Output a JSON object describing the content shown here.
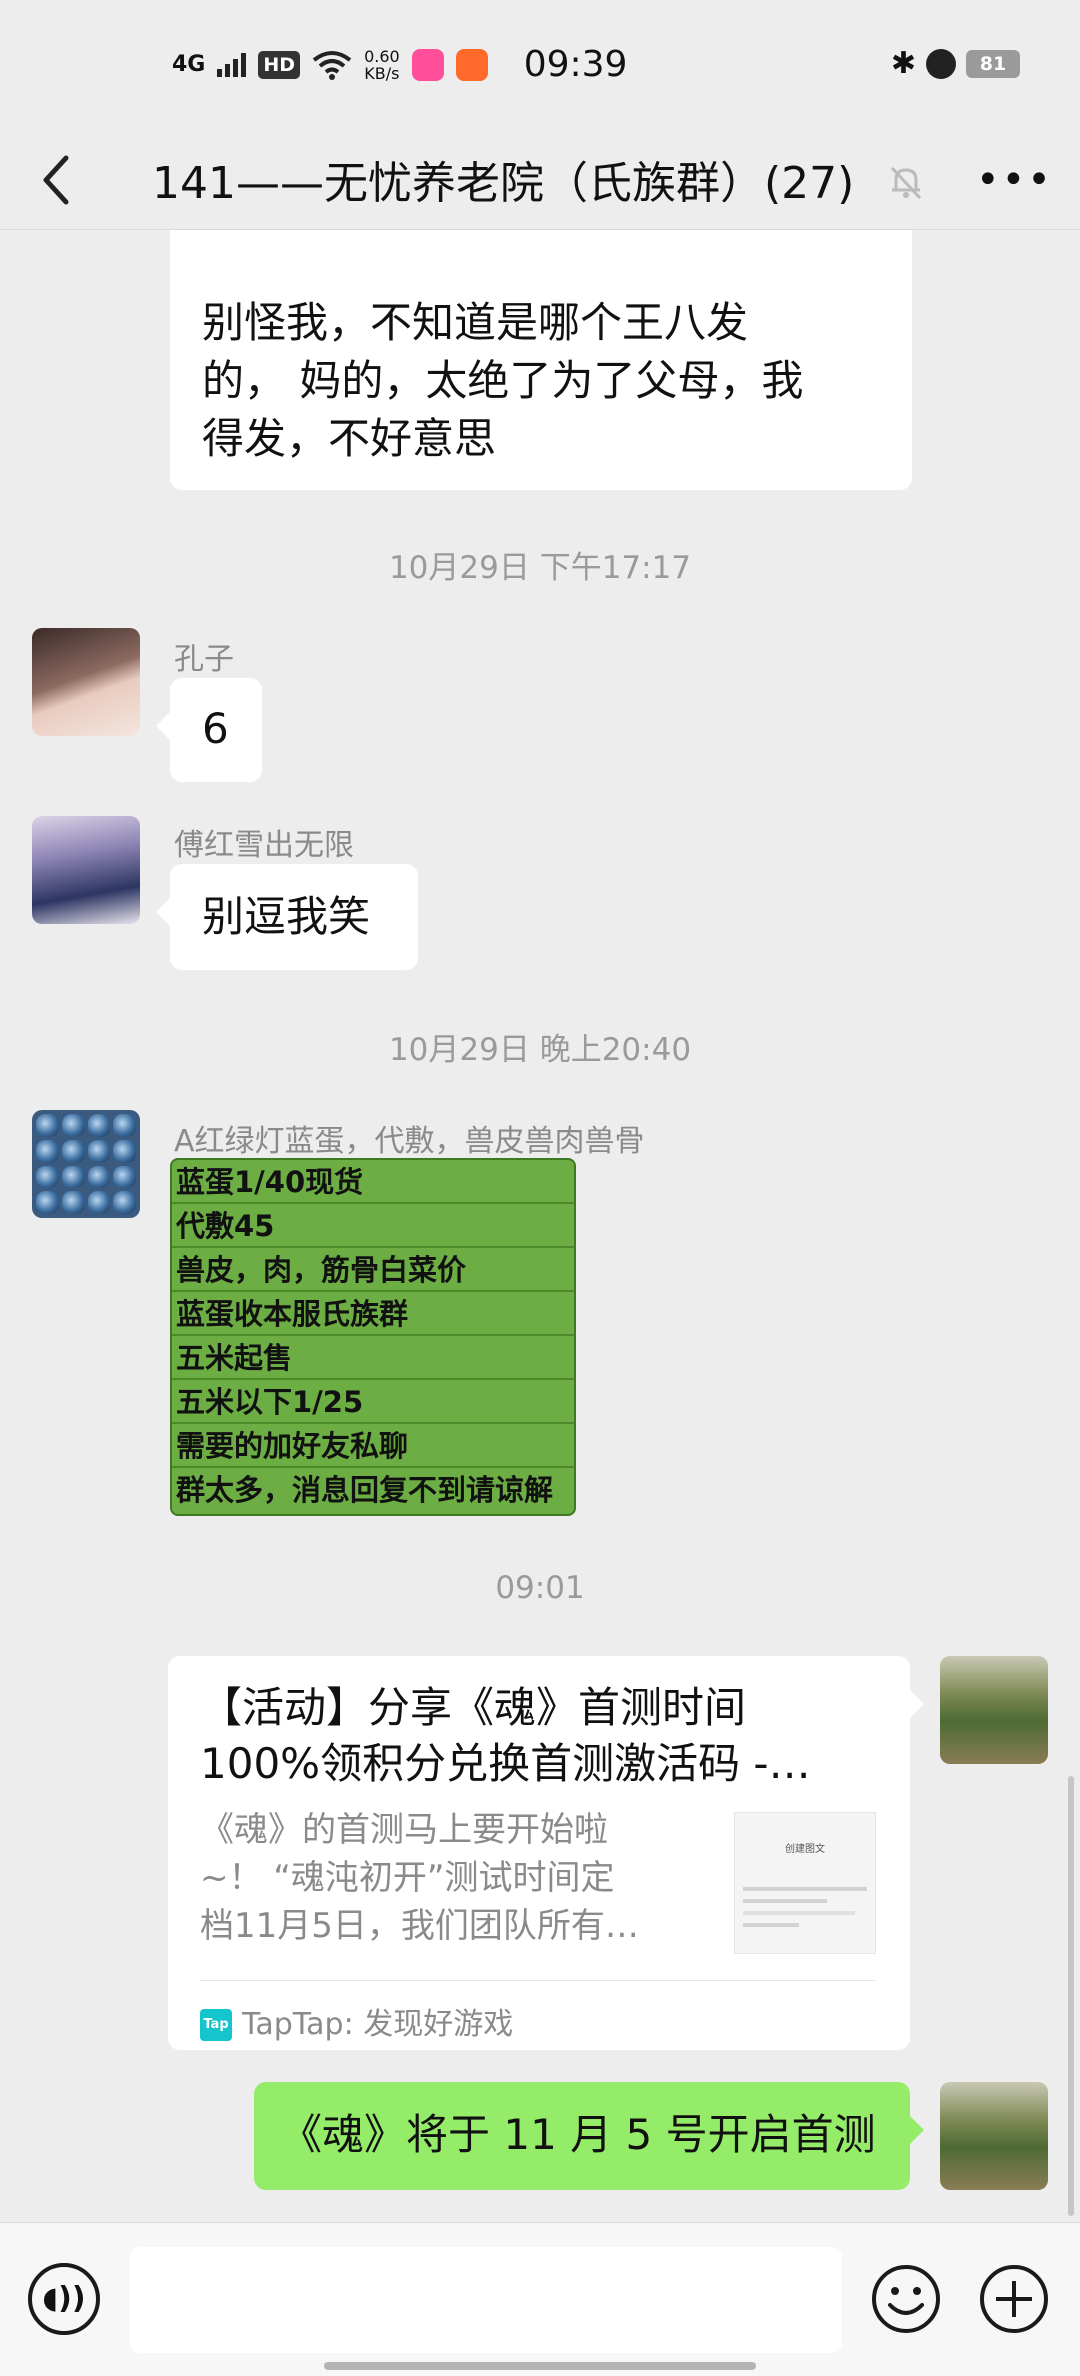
{
  "status_bar": {
    "network": "4G",
    "hd": "HD",
    "speed_value": "0.60",
    "speed_unit": "KB/s",
    "time": "09:39",
    "battery": "81"
  },
  "header": {
    "back_icon": "chevron-left",
    "title": "141——无忧养老院（氏族群）(27)",
    "mute_icon": "bell-off",
    "more_icon": "ellipsis"
  },
  "messages": {
    "m1": {
      "text_line1": "别怪我，不知道是哪个王八发",
      "text_line2": "的， 妈的，太绝了为了父母，我",
      "text_line3": "得发，不好意思"
    },
    "ts1": "10月29日 下午17:17",
    "m2": {
      "sender": "孔子",
      "text": "6"
    },
    "m3": {
      "sender": "傅红雪出无限",
      "text": "别逗我笑"
    },
    "ts2": "10月29日 晚上20:40",
    "m4": {
      "sender": "A红绿灯蓝蛋，代敷，兽皮兽肉兽骨",
      "image_lines": [
        "蓝蛋1/40现货",
        "代敷45",
        "兽皮，肉，筋骨白菜价",
        "蓝蛋收本服氏族群",
        "五米起售",
        "五米以下1/25",
        "需要的加好友私聊",
        "群太多，消息回复不到请谅解"
      ]
    },
    "ts3": "09:01",
    "m5": {
      "title_line1": "【活动】分享《魂》首测时间",
      "title_line2": "100%领积分兑换首测激活码 -…",
      "desc_line1": "《魂》的首测马上要开始啦",
      "desc_line2": "~！ “魂沌初开”测试时间定",
      "desc_line3": "档11月5日，我们团队所有…",
      "thumb_caption": "创建图文",
      "source_logo": "Tap",
      "source": "TapTap: 发现好游戏"
    },
    "m6": {
      "text": "《魂》将于 11 月 5 号开启首测"
    }
  },
  "input_bar": {
    "voice_icon": "voice",
    "emoji_icon": "smiley",
    "plus_icon": "plus"
  }
}
